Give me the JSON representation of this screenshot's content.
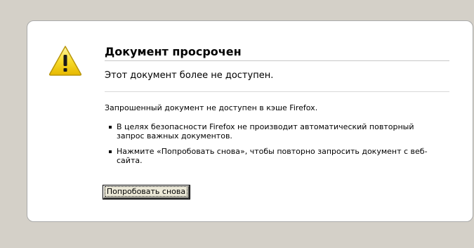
{
  "error": {
    "title": "Документ просрочен",
    "short_desc": "Этот документ более не доступен.",
    "long_desc": "Запрошенный документ не доступен в кэше Firefox.",
    "bullets": [
      "В целях безопасности Firefox не производит автоматический повторный запрос важных документов.",
      "Нажмите «Попробовать снова», чтобы повторно запросить документ с веб-сайта."
    ],
    "try_again_label": "Попробовать снова",
    "icon": "warning-icon"
  },
  "colors": {
    "page_background": "#d4d0c8",
    "box_background": "#ffffff",
    "warning_yellow": "#f5d11b"
  }
}
